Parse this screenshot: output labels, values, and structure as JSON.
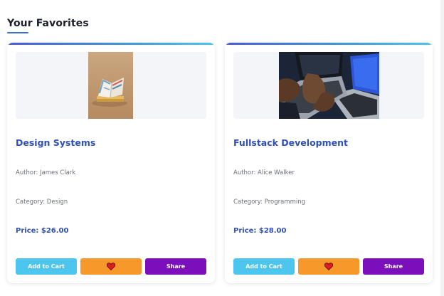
{
  "page": {
    "title": "Your Favorites"
  },
  "cards": [
    {
      "title": "Design Systems",
      "author": "Author: James Clark",
      "category": "Category: Design",
      "price": "Price: $26.00",
      "image_icon": "open-book-photo",
      "buttons": {
        "cart": "Add to Cart",
        "favorite_icon": "heart-icon",
        "share": "Share"
      }
    },
    {
      "title": "Fullstack Development",
      "author": "Author: Alice Walker",
      "category": "Category: Programming",
      "price": "Price: $28.00",
      "image_icon": "laptop-typing-photo",
      "buttons": {
        "cart": "Add to Cart",
        "favorite_icon": "heart-icon",
        "share": "Share"
      }
    }
  ],
  "colors": {
    "accent": "#2f4fb9",
    "cart_button": "#4cc6ee",
    "favorite_button": "#f7982a",
    "share_button": "#7a0fbb",
    "heart": "#e01b24"
  }
}
